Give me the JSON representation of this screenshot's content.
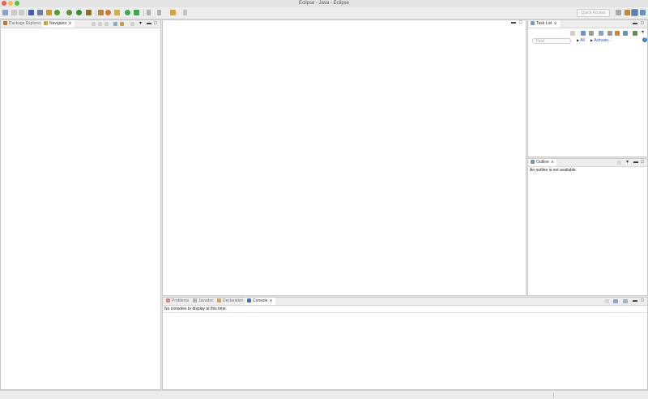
{
  "window": {
    "title": "Eclipse - Java - Eclipse",
    "traffic_colors": {
      "close": "#ee5e57",
      "minimize": "#f5bd4f",
      "zoom": "#58c22f"
    }
  },
  "toolbar": {
    "icons": [
      "new-icon",
      "save-icon",
      "print-icon",
      "terminal-icon",
      "skip-breakpoints-icon",
      "debug-icon",
      "run-icon",
      "coverage-icon",
      "external-tools-icon",
      "new-java-project-icon",
      "new-package-icon",
      "new-class-icon",
      "open-type-icon",
      "build-icon",
      "search-icon",
      "back-icon",
      "forward-icon",
      "navigate-icon"
    ],
    "quick_access_placeholder": "Quick Access",
    "perspectives": [
      "open-perspective-icon",
      "java-ee-perspective-icon",
      "java-perspective-icon",
      "debug-perspective-icon"
    ]
  },
  "left_panel": {
    "tabs": [
      {
        "label": "Package Explorer",
        "active": false
      },
      {
        "label": "Navigator",
        "active": true,
        "close": "⨯"
      }
    ],
    "minimize": "▬",
    "maximize": "□"
  },
  "editor": {
    "minimize": "▬",
    "maximize": "□"
  },
  "task_list": {
    "tab": "Task List",
    "close": "⨯",
    "find_placeholder": "Find",
    "filter_all": "All",
    "activate": "Activate...",
    "help": "?"
  },
  "outline": {
    "tab": "Outline",
    "close": "⨯",
    "message": "An outline is not available."
  },
  "bottom": {
    "tabs": [
      {
        "label": "Problems",
        "active": false
      },
      {
        "label": "Javadoc",
        "active": false
      },
      {
        "label": "Declaration",
        "active": false
      },
      {
        "label": "Console",
        "active": true,
        "close": "⨯"
      }
    ],
    "message": "No consoles to display at this time."
  },
  "status": {
    "text": ""
  }
}
